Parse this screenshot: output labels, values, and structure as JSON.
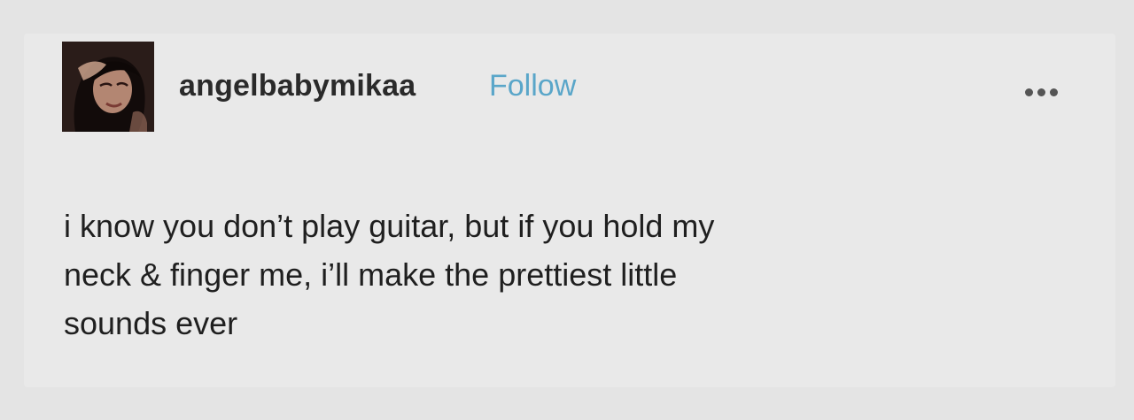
{
  "post": {
    "username": "angelbabymikaa",
    "follow_label": "Follow",
    "follow_color": "#5aa6c9",
    "more_icon": "more-horizontal-icon",
    "avatar_icon": "avatar-image",
    "text_lines": [
      "i know you don’t play guitar, but if you hold my",
      "neck & finger me, i’ll make the prettiest little",
      "sounds ever"
    ]
  }
}
